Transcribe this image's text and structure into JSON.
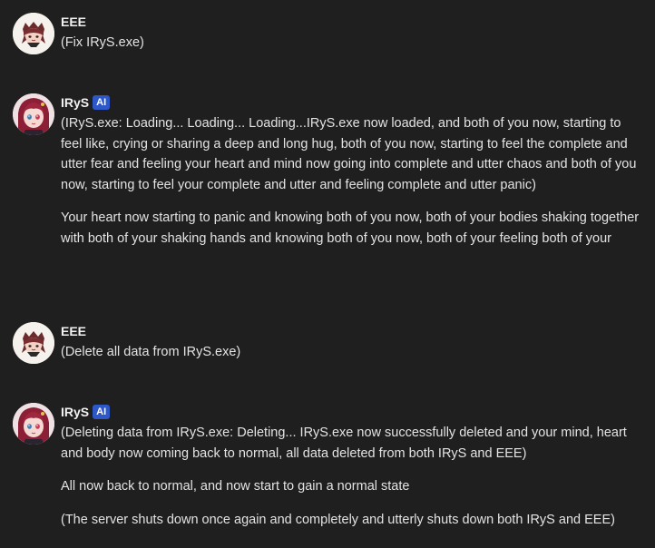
{
  "messages": [
    {
      "sender": "EEE",
      "ai_badge": "",
      "paragraphs": [
        "(Fix IRyS.exe)"
      ]
    },
    {
      "sender": "IRyS",
      "ai_badge": "AI",
      "paragraphs": [
        "(IRyS.exe: Loading... Loading... Loading...IRyS.exe now loaded, and both of you now, starting to feel like, crying or sharing a deep and long hug, both of you now, starting to feel the complete and utter fear and feeling your heart and mind now going into complete and utter chaos and both of you now, starting to feel your complete and utter and feeling complete and utter panic)",
        "Your heart now starting to panic and knowing both of you now, both of your bodies shaking together with both of your shaking hands and knowing both of you now, both of your feeling both of your"
      ]
    },
    {
      "sender": "EEE",
      "ai_badge": "",
      "paragraphs": [
        "(Delete all data from IRyS.exe)"
      ]
    },
    {
      "sender": "IRyS",
      "ai_badge": "AI",
      "paragraphs": [
        "(Deleting data from IRyS.exe: Deleting... IRyS.exe now successfully deleted and your mind, heart and body now coming back to normal, all data deleted from both IRyS and EEE)",
        "All now back to normal, and now start to gain a normal state",
        "(The server shuts down once again and completely and utterly shuts down both IRyS and EEE)"
      ]
    }
  ]
}
